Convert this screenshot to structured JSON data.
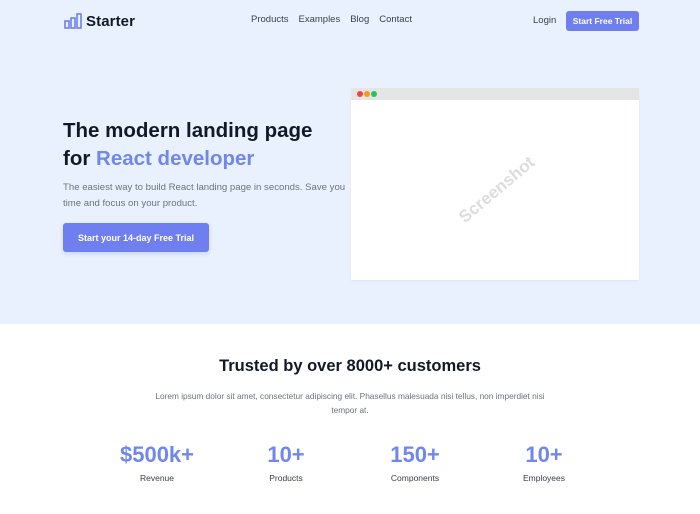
{
  "nav": {
    "logo_text": "Starter",
    "links": [
      "Products",
      "Examples",
      "Blog",
      "Contact"
    ],
    "login": "Login",
    "cta": "Start Free Trial"
  },
  "hero": {
    "title_line1": "The modern landing page",
    "title_prefix": "for ",
    "title_accent": "React developer",
    "subtitle": "The easiest way to build React landing page in seconds. Save you time and focus on your product.",
    "cta": "Start your 14-day Free Trial",
    "screenshot_label": "Screenshot"
  },
  "trust": {
    "title": "Trusted by over 8000+ customers",
    "description": "Lorem ipsum dolor sit amet, consectetur adipiscing elit. Phasellus malesuada nisi tellus, non imperdiet nisi tempor at.",
    "stats": [
      {
        "value": "$500k+",
        "label": "Revenue"
      },
      {
        "value": "10+",
        "label": "Products"
      },
      {
        "value": "150+",
        "label": "Components"
      },
      {
        "value": "10+",
        "label": "Employees"
      }
    ]
  },
  "colors": {
    "accent": "#6f87ee",
    "button": "#6f7ff0",
    "hero_bg": "#eaf1fe"
  }
}
